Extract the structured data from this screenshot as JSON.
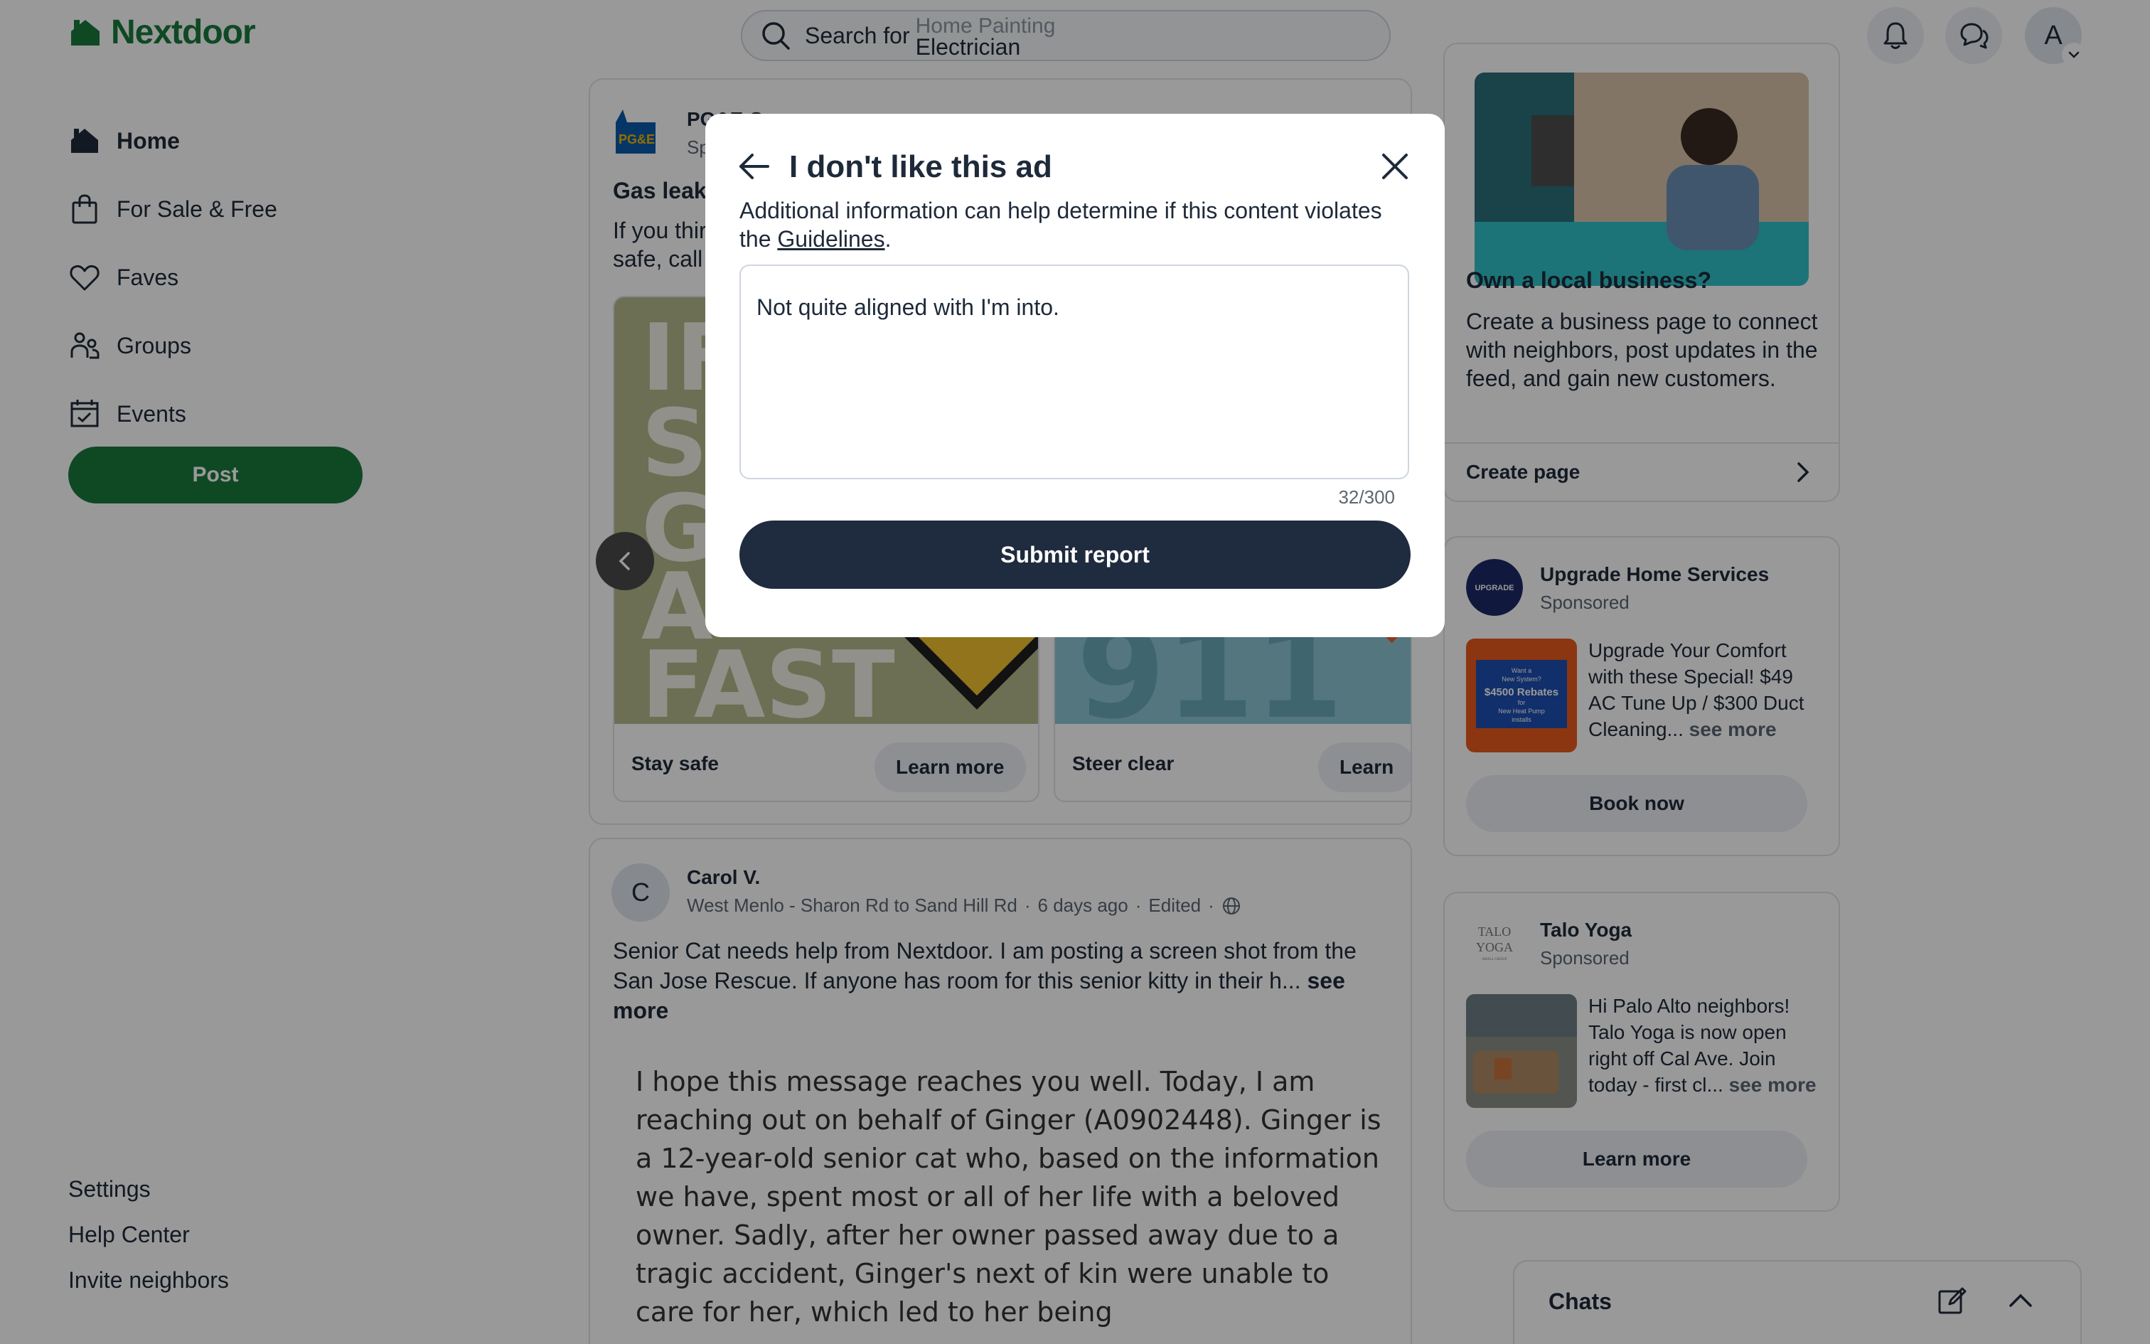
{
  "header": {
    "logo_text": "Nextdoor",
    "search_prefix": "Search for",
    "search_rotating_prev": "Home Painting",
    "search_rotating_current": "Electrician",
    "avatar_initial": "A",
    "icons": [
      "search-icon",
      "bell-icon",
      "chat-bubbles-icon",
      "chevron-down-icon"
    ]
  },
  "nav": {
    "items": [
      {
        "label": "Home",
        "icon": "house-icon",
        "active": true
      },
      {
        "label": "For Sale & Free",
        "icon": "shopping-bag-icon",
        "active": false
      },
      {
        "label": "Faves",
        "icon": "heart-icon",
        "active": false
      },
      {
        "label": "Groups",
        "icon": "people-icon",
        "active": false
      },
      {
        "label": "Events",
        "icon": "calendar-check-icon",
        "active": false
      }
    ],
    "post_label": "Post",
    "footer_links": [
      "Settings",
      "Help Center",
      "Invite neighbors"
    ]
  },
  "feed": {
    "ad": {
      "advertiser": "PG&E C",
      "sponsored": "Sp",
      "title": "Gas leaks",
      "body_line1": "If you thir",
      "body_line2": "safe, call",
      "logo_text": "PG&E",
      "slides": [
        {
          "caption": "Stay safe",
          "button": "Learn more",
          "art_text": [
            "IF",
            "SM",
            "GA",
            "A",
            "FAST"
          ]
        },
        {
          "caption": "Steer clear",
          "button": "Learn",
          "art_text": "911"
        }
      ]
    },
    "post": {
      "avatar_initial": "C",
      "author": "Carol V.",
      "location": "West Menlo - Sharon Rd to Sand Hill Rd",
      "age": "6 days ago",
      "edited": "Edited",
      "text": "Senior Cat needs help from Nextdoor.  I am posting a screen shot from the San Jose Rescue.  If anyone has room for this senior kitty in their h...",
      "see_more": "see more",
      "image_text": "I hope this message reaches you well. Today, I am reaching out on behalf of Ginger (A0902448). Ginger is a 12-year-old senior cat who, based on the information we have, spent most or all of her life with a beloved owner. Sadly, after her owner passed away due to a tragic accident, Ginger's next of kin were unable to care for her, which led to her being"
    }
  },
  "rail": {
    "business": {
      "title": "Own a local business?",
      "body": "Create a business page to connect with neighbors, post updates in the feed, and gain new customers.",
      "link": "Create page"
    },
    "sponsored": [
      {
        "name": "Upgrade Home Services",
        "sub": "Sponsored",
        "text": "Upgrade Your Comfort with these Special! $49 AC Tune Up / $300 Duct Cleaning...",
        "see_more": "see more",
        "button": "Book now",
        "thumb_text": [
          "Want a",
          "New System?",
          "$4500 Rebates",
          "for",
          "New Heat Pump",
          "installs"
        ],
        "logo_text": "UPGRADE"
      },
      {
        "name": "Talo Yoga",
        "sub": "Sponsored",
        "text": "Hi Palo Alto neighbors! Talo Yoga is now open right off Cal Ave. Join today - first cl...",
        "see_more": "see more",
        "button": "Learn more",
        "logo_text": [
          "TALO",
          "YOGA",
          "SMALL GROUP"
        ]
      }
    ],
    "chats_label": "Chats"
  },
  "modal": {
    "title": "I don't like this ad",
    "desc_prefix": "Additional information can help determine if this content violates the ",
    "desc_link": "Guidelines",
    "desc_suffix": ".",
    "textarea_value": "Not quite aligned with I'm into.",
    "counter": "32/300",
    "submit_label": "Submit report"
  },
  "colors": {
    "brand_green": "#1a7a3c",
    "submit_navy": "#1f2b3e",
    "overlay": "rgba(0,0,0,0.4)"
  }
}
